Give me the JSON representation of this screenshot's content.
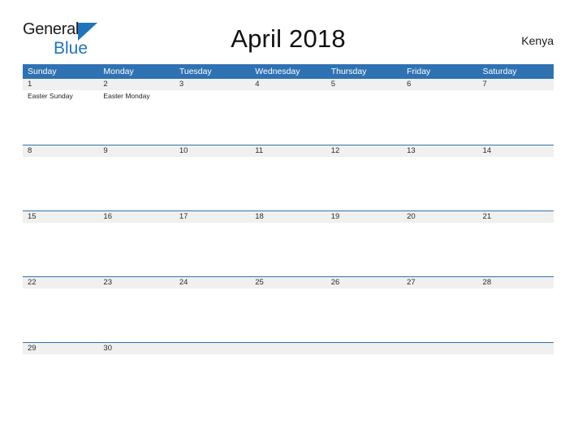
{
  "brand": {
    "name_part1": "General",
    "name_part2": "Blue",
    "flag_icon": "triangle-flag-icon",
    "accent_color": "#1f74bd"
  },
  "header": {
    "title": "April 2018",
    "region": "Kenya"
  },
  "theme": {
    "header_blue": "#2f72b3",
    "row_gray": "#f0f0f0",
    "text_dark": "#1a1a1a"
  },
  "calendar": {
    "month": "April",
    "year": "2018",
    "day_headers": [
      "Sunday",
      "Monday",
      "Tuesday",
      "Wednesday",
      "Thursday",
      "Friday",
      "Saturday"
    ],
    "weeks": [
      {
        "days": [
          {
            "number": "1",
            "event": "Easter Sunday"
          },
          {
            "number": "2",
            "event": "Easter Monday"
          },
          {
            "number": "3",
            "event": ""
          },
          {
            "number": "4",
            "event": ""
          },
          {
            "number": "5",
            "event": ""
          },
          {
            "number": "6",
            "event": ""
          },
          {
            "number": "7",
            "event": ""
          }
        ]
      },
      {
        "days": [
          {
            "number": "8",
            "event": ""
          },
          {
            "number": "9",
            "event": ""
          },
          {
            "number": "10",
            "event": ""
          },
          {
            "number": "11",
            "event": ""
          },
          {
            "number": "12",
            "event": ""
          },
          {
            "number": "13",
            "event": ""
          },
          {
            "number": "14",
            "event": ""
          }
        ]
      },
      {
        "days": [
          {
            "number": "15",
            "event": ""
          },
          {
            "number": "16",
            "event": ""
          },
          {
            "number": "17",
            "event": ""
          },
          {
            "number": "18",
            "event": ""
          },
          {
            "number": "19",
            "event": ""
          },
          {
            "number": "20",
            "event": ""
          },
          {
            "number": "21",
            "event": ""
          }
        ]
      },
      {
        "days": [
          {
            "number": "22",
            "event": ""
          },
          {
            "number": "23",
            "event": ""
          },
          {
            "number": "24",
            "event": ""
          },
          {
            "number": "25",
            "event": ""
          },
          {
            "number": "26",
            "event": ""
          },
          {
            "number": "27",
            "event": ""
          },
          {
            "number": "28",
            "event": ""
          }
        ]
      },
      {
        "days": [
          {
            "number": "29",
            "event": ""
          },
          {
            "number": "30",
            "event": ""
          },
          {
            "number": "",
            "event": ""
          },
          {
            "number": "",
            "event": ""
          },
          {
            "number": "",
            "event": ""
          },
          {
            "number": "",
            "event": ""
          },
          {
            "number": "",
            "event": ""
          }
        ]
      }
    ]
  }
}
